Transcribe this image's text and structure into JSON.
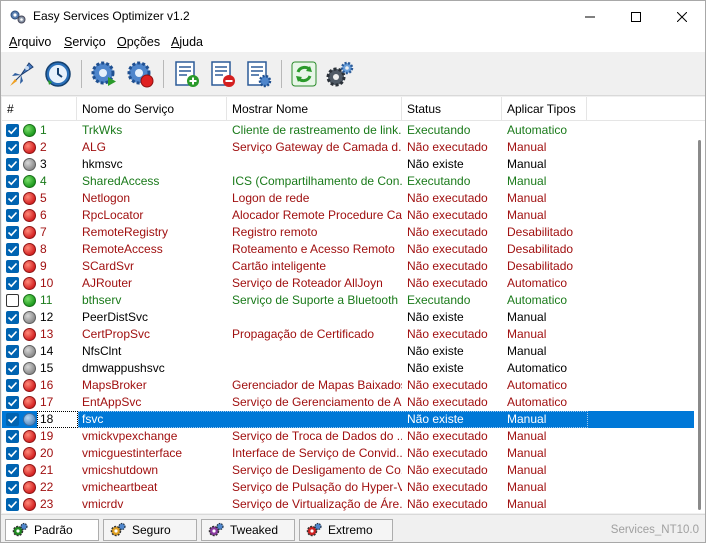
{
  "window": {
    "title": "Easy Services Optimizer v1.2"
  },
  "menu": {
    "items": [
      {
        "u": "A",
        "rest": "rquivo"
      },
      {
        "u": "S",
        "rest": "erviço"
      },
      {
        "u": "O",
        "rest": "pções"
      },
      {
        "u": "A",
        "rest": "juda"
      }
    ]
  },
  "toolbar": {
    "icons": [
      "rocket-icon",
      "restore-clock-icon",
      "gear-play-icon",
      "gear-stop-icon",
      "list-add-icon",
      "list-remove-icon",
      "list-settings-icon",
      "refresh-icon",
      "gears-icon"
    ]
  },
  "table": {
    "columns": [
      "#",
      "Nome do Serviço",
      "Mostrar Nome",
      "Status",
      "Aplicar Tipos"
    ],
    "rows": [
      {
        "checked": true,
        "dot": "green",
        "color": "green",
        "num": "1",
        "name": "TrkWks",
        "display": "Cliente de rastreamento de link...",
        "status": "Executando",
        "type": "Automatico"
      },
      {
        "checked": true,
        "dot": "red",
        "color": "red",
        "num": "2",
        "name": "ALG",
        "display": "Serviço Gateway de Camada d...",
        "status": "Não executado",
        "type": "Manual"
      },
      {
        "checked": true,
        "dot": "gray",
        "color": "black",
        "num": "3",
        "name": "hkmsvc",
        "display": "",
        "status": "Não existe",
        "type": "Manual"
      },
      {
        "checked": true,
        "dot": "green",
        "color": "green",
        "num": "4",
        "name": "SharedAccess",
        "display": "ICS (Compartilhamento de Con...",
        "status": "Executando",
        "type": "Manual"
      },
      {
        "checked": true,
        "dot": "red",
        "color": "red",
        "num": "5",
        "name": "Netlogon",
        "display": "Logon de rede",
        "status": "Não executado",
        "type": "Manual"
      },
      {
        "checked": true,
        "dot": "red",
        "color": "red",
        "num": "6",
        "name": "RpcLocator",
        "display": "Alocador Remote Procedure Ca...",
        "status": "Não executado",
        "type": "Manual"
      },
      {
        "checked": true,
        "dot": "red",
        "color": "red",
        "num": "7",
        "name": "RemoteRegistry",
        "display": "Registro remoto",
        "status": "Não executado",
        "type": "Desabilitado"
      },
      {
        "checked": true,
        "dot": "red",
        "color": "red",
        "num": "8",
        "name": "RemoteAccess",
        "display": "Roteamento e Acesso Remoto",
        "status": "Não executado",
        "type": "Desabilitado"
      },
      {
        "checked": true,
        "dot": "red",
        "color": "red",
        "num": "9",
        "name": "SCardSvr",
        "display": "Cartão inteligente",
        "status": "Não executado",
        "type": "Desabilitado"
      },
      {
        "checked": true,
        "dot": "red",
        "color": "red",
        "num": "10",
        "name": "AJRouter",
        "display": "Serviço de Roteador AllJoyn",
        "status": "Não executado",
        "type": "Automatico"
      },
      {
        "checked": false,
        "dot": "green",
        "color": "green",
        "num": "11",
        "name": "bthserv",
        "display": "Serviço de Suporte a Bluetooth",
        "status": "Executando",
        "type": "Automatico"
      },
      {
        "checked": true,
        "dot": "gray",
        "color": "black",
        "num": "12",
        "name": "PeerDistSvc",
        "display": "",
        "status": "Não existe",
        "type": "Manual"
      },
      {
        "checked": true,
        "dot": "red",
        "color": "red",
        "num": "13",
        "name": "CertPropSvc",
        "display": "Propagação de Certificado",
        "status": "Não executado",
        "type": "Manual"
      },
      {
        "checked": true,
        "dot": "gray",
        "color": "black",
        "num": "14",
        "name": "NfsClnt",
        "display": "",
        "status": "Não existe",
        "type": "Manual"
      },
      {
        "checked": true,
        "dot": "gray",
        "color": "black",
        "num": "15",
        "name": "dmwappushsvc",
        "display": "",
        "status": "Não existe",
        "type": "Automatico"
      },
      {
        "checked": true,
        "dot": "red",
        "color": "red",
        "num": "16",
        "name": "MapsBroker",
        "display": "Gerenciador de Mapas Baixados",
        "status": "Não executado",
        "type": "Automatico"
      },
      {
        "checked": true,
        "dot": "red",
        "color": "red",
        "num": "17",
        "name": "EntAppSvc",
        "display": "Serviço de Gerenciamento de A...",
        "status": "Não executado",
        "type": "Automatico"
      },
      {
        "checked": true,
        "dot": "blue",
        "color": "black",
        "num": "18",
        "name": "fsvc",
        "display": "",
        "status": "Não existe",
        "type": "Manual",
        "selected": true
      },
      {
        "checked": true,
        "dot": "red",
        "color": "red",
        "num": "19",
        "name": "vmickvpexchange",
        "display": "Serviço de Troca de Dados do ...",
        "status": "Não executado",
        "type": "Manual"
      },
      {
        "checked": true,
        "dot": "red",
        "color": "red",
        "num": "20",
        "name": "vmicguestinterface",
        "display": "Interface de Serviço de Convid...",
        "status": "Não executado",
        "type": "Manual"
      },
      {
        "checked": true,
        "dot": "red",
        "color": "red",
        "num": "21",
        "name": "vmicshutdown",
        "display": "Serviço de Desligamento de Co...",
        "status": "Não executado",
        "type": "Manual"
      },
      {
        "checked": true,
        "dot": "red",
        "color": "red",
        "num": "22",
        "name": "vmicheartbeat",
        "display": "Serviço de Pulsação do Hyper-V",
        "status": "Não executado",
        "type": "Manual"
      },
      {
        "checked": true,
        "dot": "red",
        "color": "red",
        "num": "23",
        "name": "vmicrdv",
        "display": "Serviço de Virtualização de Áre...",
        "status": "Não executado",
        "type": "Manual"
      }
    ]
  },
  "tabs": [
    {
      "label": "Padrão",
      "active": true,
      "gear": "#1e8c1e"
    },
    {
      "label": "Seguro",
      "active": false,
      "gear": "#e0a020"
    },
    {
      "label": "Tweaked",
      "active": false,
      "gear": "#8a3aa0"
    },
    {
      "label": "Extremo",
      "active": false,
      "gear": "#d02020"
    }
  ],
  "status": {
    "right_text": "Services_NT10.0"
  }
}
